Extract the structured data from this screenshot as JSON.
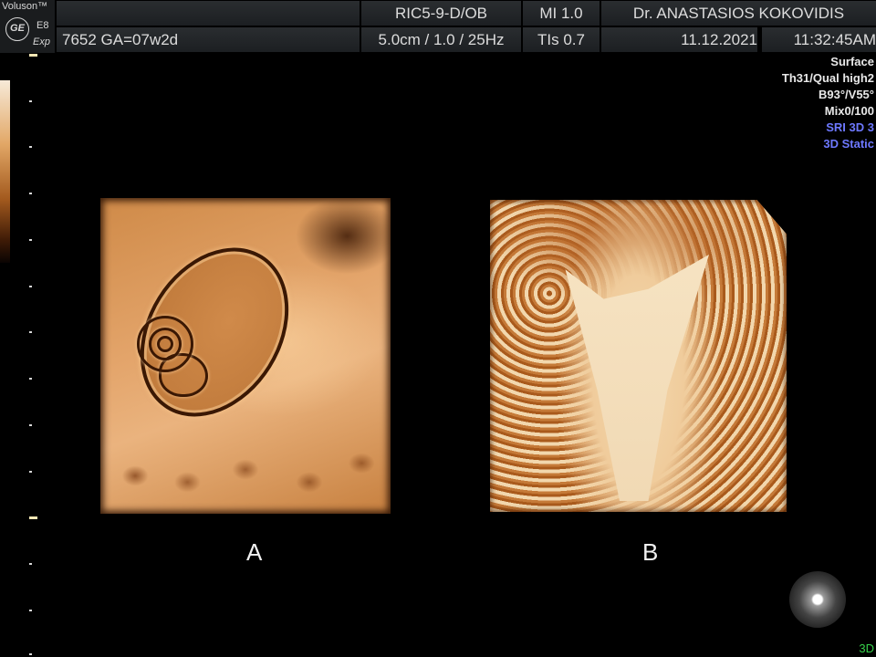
{
  "header": {
    "brand": "Voluson™",
    "logo": "GE",
    "model": "E8",
    "model_suffix": "Exp",
    "probe": "RIC5-9-D/OB",
    "mi": "MI  1.0",
    "doctor": "Dr. ANASTASIOS KOKOVIDIS",
    "patient": "7652  GA=07w2d",
    "depth_info": "5.0cm / 1.0 / 25Hz",
    "tis": "TIs  0.7",
    "date": "11.12.2021",
    "time": "11:32:45AM"
  },
  "info_panel": {
    "render_mode": "Surface",
    "quality": "Th31/Qual high2",
    "angles": "B93°/V55°",
    "mix": "Mix0/100",
    "sri": "SRI 3D 3",
    "mode": "3D Static"
  },
  "images": {
    "label_a": "A",
    "label_b": "B"
  },
  "mode_indicator": "3D",
  "colors": {
    "info_highlight": "#6d78ff",
    "mode_indicator": "#36d14a"
  }
}
